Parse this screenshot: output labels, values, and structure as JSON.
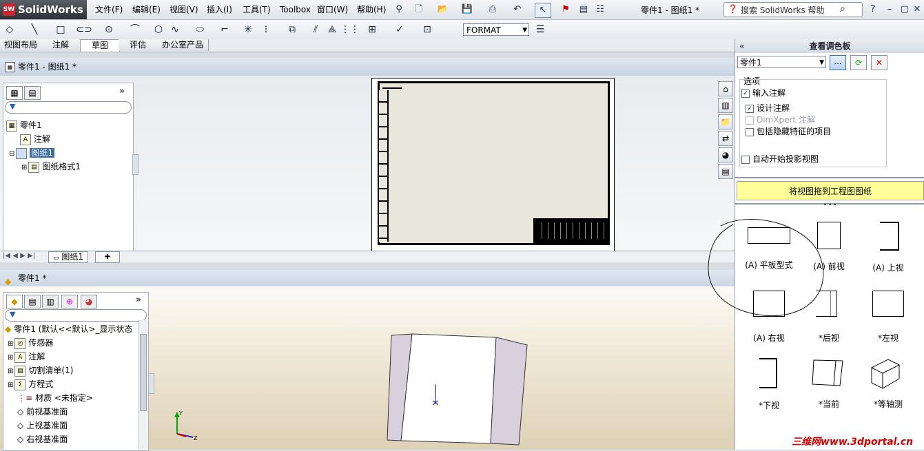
{
  "app": {
    "name": "SolidWorks",
    "logo_mark": "SW",
    "window_title": "零件1 - 图纸1 *"
  },
  "menu": [
    "文件(F)",
    "编辑(E)",
    "视图(V)",
    "插入(I)",
    "工具(T)",
    "Toolbox",
    "窗口(W)",
    "帮助(H)"
  ],
  "search": {
    "placeholder": "搜索 SolidWorks 帮助"
  },
  "toolbar": {
    "format_value": "FORMAT"
  },
  "tabs": [
    "视图布局",
    "注解",
    "草图",
    "评估",
    "办公室产品"
  ],
  "drawing": {
    "title": "零件1 - 图纸1 *",
    "tree": [
      {
        "label": "零件1",
        "icon": "drawing-icon"
      },
      {
        "label": "注解",
        "icon": "annotation-icon"
      },
      {
        "label": "图纸1",
        "icon": "sheet-icon",
        "selected": true
      },
      {
        "label": "图纸格式1",
        "icon": "sheet-format-icon"
      }
    ],
    "sheet_tab": "图纸1"
  },
  "model": {
    "title": "零件1 *",
    "tree": [
      {
        "label": "零件1  (默认<<默认>_显示状态",
        "icon": "part-icon"
      },
      {
        "label": "传感器",
        "icon": "sensor-icon"
      },
      {
        "label": "注解",
        "icon": "annotation-icon"
      },
      {
        "label": "切割清单(1)",
        "icon": "cutlist-icon"
      },
      {
        "label": "方程式",
        "icon": "equation-icon"
      },
      {
        "label": "材质 <未指定>",
        "icon": "material-icon"
      },
      {
        "label": "前视基准面",
        "icon": "plane-icon"
      },
      {
        "label": "上视基准面",
        "icon": "plane-icon"
      },
      {
        "label": "右视基准面",
        "icon": "plane-icon"
      }
    ]
  },
  "palette": {
    "header": "查看调色板",
    "part_select": "零件1",
    "options_label": "选项",
    "options": [
      {
        "label": "输入注解",
        "checked": true
      },
      {
        "label": "设计注解",
        "checked": true
      },
      {
        "label": "DimXpert 注解",
        "checked": false,
        "disabled": true
      },
      {
        "label": "包括隐藏特征的项目",
        "checked": false
      }
    ],
    "auto_projection": {
      "label": "自动开始投影视图",
      "checked": false
    },
    "drag_hint": "将视图拖到工程图图纸",
    "views": [
      "(A) 平板型式",
      "(A) 前视",
      "(A) 上视",
      "(A) 右视",
      "*后视",
      "*左视",
      "*下视",
      "*当前",
      "*等轴测"
    ]
  },
  "watermark": "三维网www.3dportal.cn",
  "colors": {
    "accent": "#c8262e",
    "hint_bg": "#ffff99",
    "selected": "#3a6ea5"
  }
}
